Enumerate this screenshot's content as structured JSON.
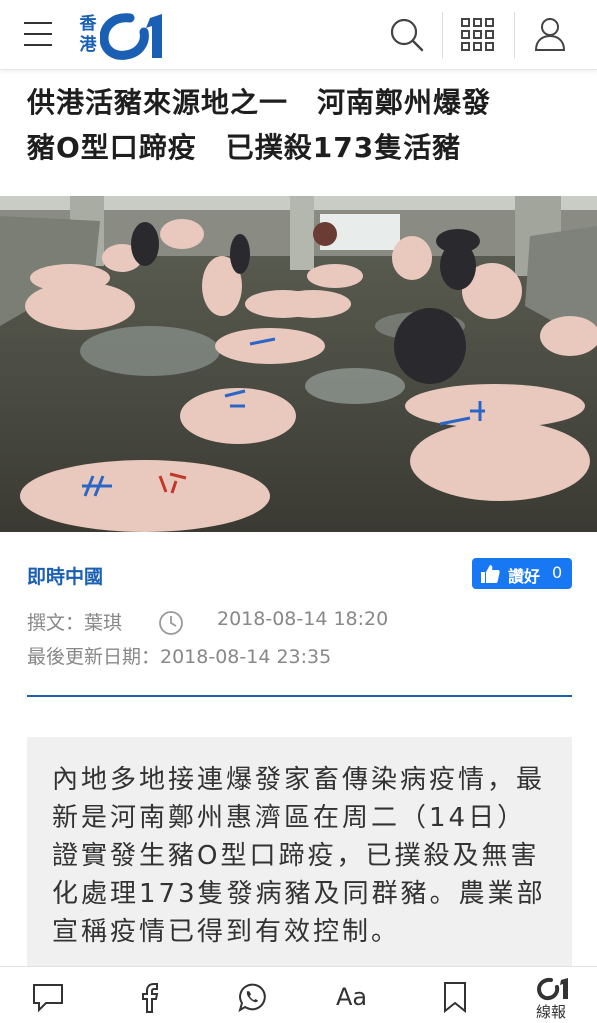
{
  "header": {
    "logo_text_line1": "香",
    "logo_text_line2": "港",
    "icons": [
      "menu-icon",
      "search-icon",
      "grid-icon",
      "user-icon"
    ],
    "brand_color": "#1a5fb4"
  },
  "article": {
    "headline_line1": "供港活豬來源地之一　河南鄭州爆發",
    "headline_line2": "豬O型口蹄疫　已撲殺173隻活豬",
    "category": "即時中國",
    "like_label": "讚好",
    "like_count": "0",
    "author": "撰文：葉琪",
    "published": "2018-08-14 18:20",
    "updated": "最後更新日期：2018-08-14 23:35",
    "summary": "內地多地接連爆發家畜傳染病疫情，最新是河南鄭州惠濟區在周二（14日）證實發生豬O型口蹄疫，已撲殺及無害化處理173隻發病豬及同群豬。農業部宣稱疫情已得到有效控制。"
  },
  "bottom_bar": {
    "font_size_label": "Aa",
    "app_label": "線報",
    "icons": [
      "comment-icon",
      "facebook-icon",
      "whatsapp-icon",
      "font-size-icon",
      "bookmark-icon",
      "app-logo-icon"
    ]
  }
}
